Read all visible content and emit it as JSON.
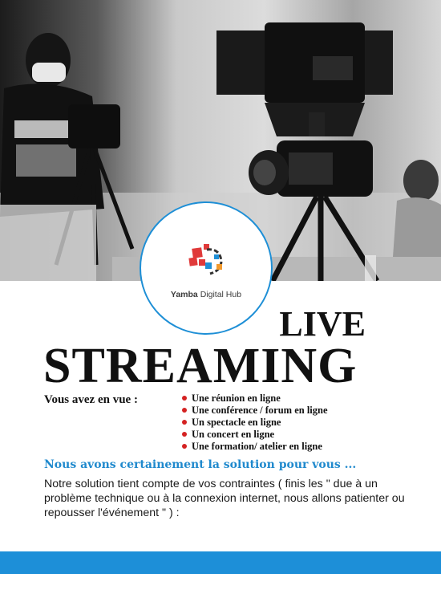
{
  "logo": {
    "brand_bold": "Yamba",
    "brand_rest": " Digital Hub",
    "colors": {
      "red": "#e03a3a",
      "blue": "#1e8fd6",
      "orange": "#f29a2e",
      "dark": "#333333"
    }
  },
  "headline": {
    "line1": "LIVE",
    "line2": "STREAMING"
  },
  "intro_label": "Vous avez en vue :",
  "events": [
    "Une réunion en ligne",
    "Une conférence / forum en ligne",
    "Un spectacle en ligne",
    "Un concert en ligne",
    "Une formation/ atelier en ligne"
  ],
  "solution_line": "Nous avons certainement la solution pour vous ...",
  "body_text": "Notre solution tient compte de vos contraintes ( finis les \" due à un problème technique ou à la connexion internet, nous allons patienter ou repousser l'événement \" ) :",
  "colors": {
    "accent_blue": "#1d8fd8",
    "bullet_red": "#d42222",
    "text_dark": "#111111"
  }
}
